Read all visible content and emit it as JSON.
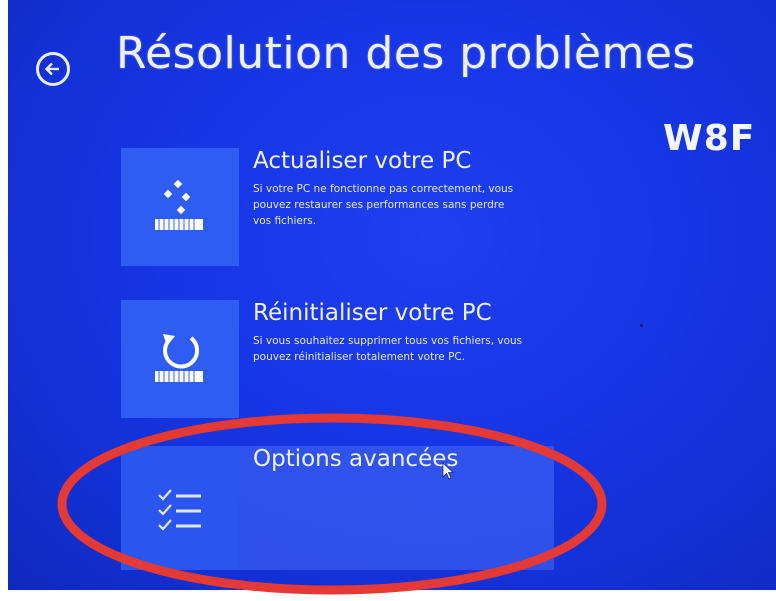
{
  "screen": {
    "title": "Résolution des problèmes",
    "watermark": "W8F",
    "background_color": "#1736e6",
    "tile_color": "#2f5cf2",
    "highlight_color": "#e53935"
  },
  "options": [
    {
      "title": "Actualiser votre PC",
      "description": "Si votre PC ne fonctionne pas correctement, vous pouvez restaurer ses performances sans perdre vos fichiers.",
      "icon": "refresh-pc-icon"
    },
    {
      "title": "Réinitialiser votre PC",
      "description": "Si vous souhaitez supprimer tous vos fichiers, vous pouvez réinitialiser totalement votre PC.",
      "icon": "reset-pc-icon"
    },
    {
      "title": "Options avancées",
      "description": "",
      "icon": "advanced-options-checklist-icon"
    }
  ],
  "icons": {
    "back": "back-arrow-icon",
    "cursor": "mouse-pointer-icon"
  }
}
